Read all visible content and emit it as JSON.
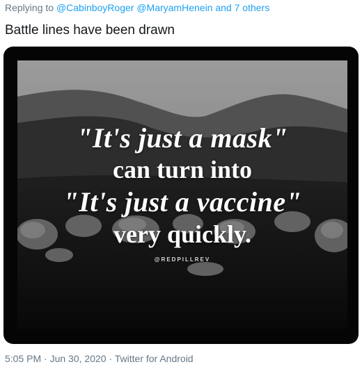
{
  "reply": {
    "prefix": "Replying to",
    "user1": "@CabinboyRoger",
    "user2": "@MaryamHenein",
    "suffix": "and 7 others"
  },
  "tweet": {
    "text": "Battle lines have been drawn"
  },
  "image": {
    "line1": "\"It's just a mask\"",
    "line2": "can turn into",
    "line3": "\"It's just a vaccine\"",
    "line4": "very quickly.",
    "watermark": "@REDPILLREV"
  },
  "meta": {
    "time": "5:05 PM",
    "date": "Jun 30, 2020",
    "source": "Twitter for Android",
    "separator": "·"
  }
}
